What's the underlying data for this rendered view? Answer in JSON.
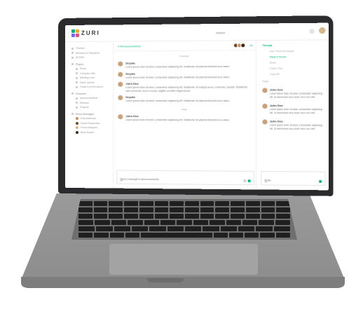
{
  "app": {
    "logo_text": "ZURI",
    "search_placeholder": "Search"
  },
  "sidebar": {
    "items": [
      {
        "label": "Threads",
        "type": "item"
      },
      {
        "label": "Mentions & Reactions",
        "type": "item"
      },
      {
        "label": "All DMs",
        "type": "item"
      },
      {
        "label": "Plugins",
        "type": "head"
      },
      {
        "label": "Music",
        "type": "sub"
      },
      {
        "label": "Company files",
        "type": "sub"
      },
      {
        "label": "Meeting room",
        "type": "sub"
      },
      {
        "label": "Sales reports",
        "type": "sub"
      },
      {
        "label": "Goals & performance",
        "type": "sub"
      },
      {
        "label": "Channels",
        "type": "head"
      },
      {
        "label": "Announcements",
        "type": "sub"
      },
      {
        "label": "Random",
        "type": "sub"
      },
      {
        "label": "Projects",
        "type": "sub"
      },
      {
        "label": "Direct Messages",
        "type": "head"
      },
      {
        "label": "Kola Ademola",
        "type": "dm"
      },
      {
        "label": "Gloria Nnaemeka",
        "type": "dm"
      },
      {
        "label": "Funmi Adeyemi",
        "type": "dm"
      },
      {
        "label": "Mark Essien",
        "type": "dm"
      }
    ]
  },
  "main": {
    "channel": "# Announcements",
    "member_count": "25",
    "days": [
      "Yesterday",
      "Today"
    ],
    "messages": [
      {
        "name": "Deyola",
        "text": "Lorem ipsum dolor sit amet, consectetur adipiscing elit. Vestibulum sit placerat tincidunt arcu varius."
      },
      {
        "name": "Deyola",
        "text": "Lorem ipsum dolor sit amet, consectetur adipiscing elit. Vestibulum sit placerat tincidunt arcu varius."
      },
      {
        "name": "John Doe",
        "text": "Lorem ipsum dolor sit amet, consectetur adipiscing elit. Vestibulum at volutpat purus, commodo, suscipit. Vestibulum ante commodo, eros in cursus, sagittis convallis magna lectus."
      },
      {
        "name": "Deyola",
        "text": "Lorem ipsum dolor sit amet, consectetur adipiscing elit. Vestibulum sit placerat tincidunt arcu varius."
      },
      {
        "name": "John Doe",
        "text": "Lorem ipsum dolor sit amet, consectetur adipiscing elit. Vestibulum sit placerat tincidunt arcu varius."
      }
    ],
    "composer_placeholder": "Send a message to #announcements"
  },
  "thread": {
    "title": "Thread",
    "options": [
      {
        "label": "Like Thread by Deyola",
        "green": false
      },
      {
        "label": "Reply to thread",
        "green": true
      },
      {
        "label": "Share",
        "green": false
      },
      {
        "label": "Follow Chat",
        "green": false
      },
      {
        "label": "Copy link",
        "green": false
      }
    ],
    "section": "Reply",
    "replies": [
      {
        "name": "John Doe",
        "text": "Lorem ipsum dolor sit amet, consectetur adipiscing elit. Ut elementum arcu dolor nunc non velit."
      },
      {
        "name": "John Doe",
        "text": "Lorem ipsum dolor sit amet, consectetur adipiscing elit. Ut elementum arcu dolor nunc non velit."
      },
      {
        "name": "John Doe",
        "text": "Lorem ipsum dolor sit amet, consectetur adipiscing elit. Ut elementum arcu dolor nunc non velit."
      }
    ],
    "composer_placeholder": "Reply..."
  },
  "colors": {
    "accent": "#00b87c",
    "lid": "#2b2b2d",
    "body": "#8c8c8c"
  }
}
